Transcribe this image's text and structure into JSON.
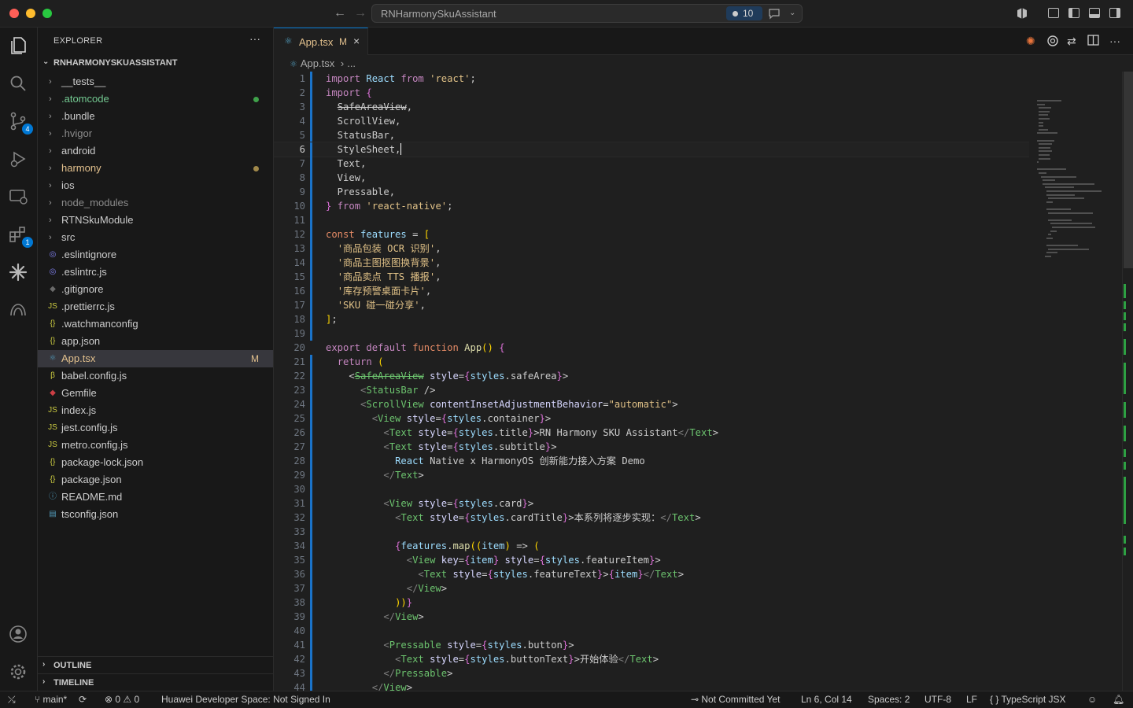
{
  "window": {
    "title": "RNHarmonySkuAssistant",
    "badge_count": "10"
  },
  "sidebar": {
    "header": "EXPLORER",
    "more": "···",
    "root": "RNHARMONYSKUASSISTANT",
    "items": [
      {
        "label": "__tests__",
        "type": "folder"
      },
      {
        "label": ".atomcode",
        "type": "folder",
        "deco": "#3fa14a"
      },
      {
        "label": ".bundle",
        "type": "folder"
      },
      {
        "label": ".hvigor",
        "type": "folder"
      },
      {
        "label": "android",
        "type": "folder"
      },
      {
        "label": "harmony",
        "type": "folder",
        "deco": "#a0884a"
      },
      {
        "label": "ios",
        "type": "folder"
      },
      {
        "label": "node_modules",
        "type": "folder"
      },
      {
        "label": "RTNSkuModule",
        "type": "folder"
      },
      {
        "label": "src",
        "type": "folder"
      },
      {
        "label": ".eslintignore",
        "type": "file",
        "icon": "eslint-icon"
      },
      {
        "label": ".eslintrc.js",
        "type": "file",
        "icon": "eslint-icon"
      },
      {
        "label": ".gitignore",
        "type": "file",
        "icon": "git-icon"
      },
      {
        "label": ".prettierrc.js",
        "type": "file",
        "icon": "js-icon"
      },
      {
        "label": ".watchmanconfig",
        "type": "file",
        "icon": "json-icon"
      },
      {
        "label": "app.json",
        "type": "file",
        "icon": "json-icon"
      },
      {
        "label": "App.tsx",
        "type": "file",
        "icon": "react-icon",
        "status": "M"
      },
      {
        "label": "babel.config.js",
        "type": "file",
        "icon": "babel-icon"
      },
      {
        "label": "Gemfile",
        "type": "file",
        "icon": "ruby-icon"
      },
      {
        "label": "index.js",
        "type": "file",
        "icon": "js-icon"
      },
      {
        "label": "jest.config.js",
        "type": "file",
        "icon": "js-icon"
      },
      {
        "label": "metro.config.js",
        "type": "file",
        "icon": "js-icon"
      },
      {
        "label": "package-lock.json",
        "type": "file",
        "icon": "json-icon"
      },
      {
        "label": "package.json",
        "type": "file",
        "icon": "json-icon"
      },
      {
        "label": "README.md",
        "type": "file",
        "icon": "info-icon"
      },
      {
        "label": "tsconfig.json",
        "type": "file",
        "icon": "ts-icon"
      }
    ],
    "outline": "OUTLINE",
    "timeline": "TIMELINE"
  },
  "activity": {
    "scm_badge": "4",
    "extensions_badge": "1"
  },
  "editor": {
    "tab_label": "App.tsx",
    "tab_status": "M",
    "breadcrumb_file": "App.tsx",
    "breadcrumb_more": "...",
    "lines": [
      "import React from 'react';",
      "import {",
      "  SafeAreaView,",
      "  ScrollView,",
      "  StatusBar,",
      "  StyleSheet,",
      "  Text,",
      "  View,",
      "  Pressable,",
      "} from 'react-native';",
      "",
      "const features = [",
      "  '商品包装 OCR 识别',",
      "  '商品主图抠图换背景',",
      "  '商品卖点 TTS 播报',",
      "  '库存预警桌面卡片',",
      "  'SKU 碰一碰分享',",
      "];",
      "",
      "export default function App() {",
      "  return (",
      "    <SafeAreaView style={styles.safeArea}>",
      "      <StatusBar />",
      "      <ScrollView contentInsetAdjustmentBehavior=\"automatic\">",
      "        <View style={styles.container}>",
      "          <Text style={styles.title}>RN Harmony SKU Assistant</Text>",
      "          <Text style={styles.subtitle}>",
      "            React Native x HarmonyOS 创新能力接入方案 Demo",
      "          </Text>",
      "",
      "          <View style={styles.card}>",
      "            <Text style={styles.cardTitle}>本系列将逐步实现：</Text>",
      "",
      "            {features.map((item) => (",
      "              <View key={item} style={styles.featureItem}>",
      "                <Text style={styles.featureText}>{item}</Text>",
      "              </View>",
      "            ))}",
      "          </View>",
      "",
      "          <Pressable style={styles.button}>",
      "            <Text style={styles.buttonText}>开始体验</Text>",
      "          </Pressable>",
      "        </View>"
    ],
    "current_line": 6
  },
  "statusbar": {
    "branch": "main*",
    "errors": "0",
    "warnings": "0",
    "huawei": "Huawei Developer Space: Not Signed In",
    "commit": "Not Committed Yet",
    "position": "Ln 6, Col 14",
    "spaces": "Spaces: 2",
    "encoding": "UTF-8",
    "eol": "LF",
    "language": "TypeScript JSX",
    "language_braces": "{ }"
  }
}
